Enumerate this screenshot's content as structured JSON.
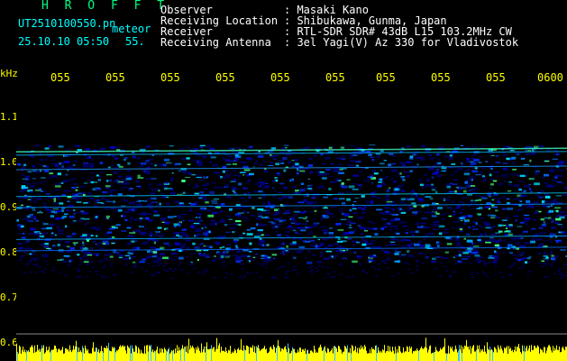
{
  "header": {
    "title": "H R O F F T",
    "filename": "UT2510100550.pn",
    "tag": "meteor",
    "datetime": "25.10.10 05:50",
    "number": "55."
  },
  "meta": [
    {
      "label": "Observer",
      "value": ": Masaki Kano"
    },
    {
      "label": "Receiving Location",
      "value": ": Shibukawa, Gunma, Japan"
    },
    {
      "label": "Receiver",
      "value": ": RTL-SDR SDR# 43dB L15 103.2MHz CW"
    },
    {
      "label": "Receiving Antenna",
      "value": ": 3el Yagi(V) Az 330 for Vladivostok"
    }
  ],
  "axes": {
    "y_unit": "kHz",
    "y_ticks": [
      "1.1",
      "1.0",
      "0.9",
      "0.8",
      "0.7",
      "0.6"
    ],
    "x_ticks": [
      "055",
      "055",
      "055",
      "055",
      "055",
      "055",
      "055",
      "055",
      "055",
      "0600"
    ]
  },
  "colors": {
    "background": "#000000",
    "header_text": "#00ffff",
    "meta_text": "#ffffff",
    "axis_text": "#ffff00",
    "spectrum_low": "#00008b",
    "spectrum_high": "#00ffff",
    "level_bar": "#ffff00"
  }
}
